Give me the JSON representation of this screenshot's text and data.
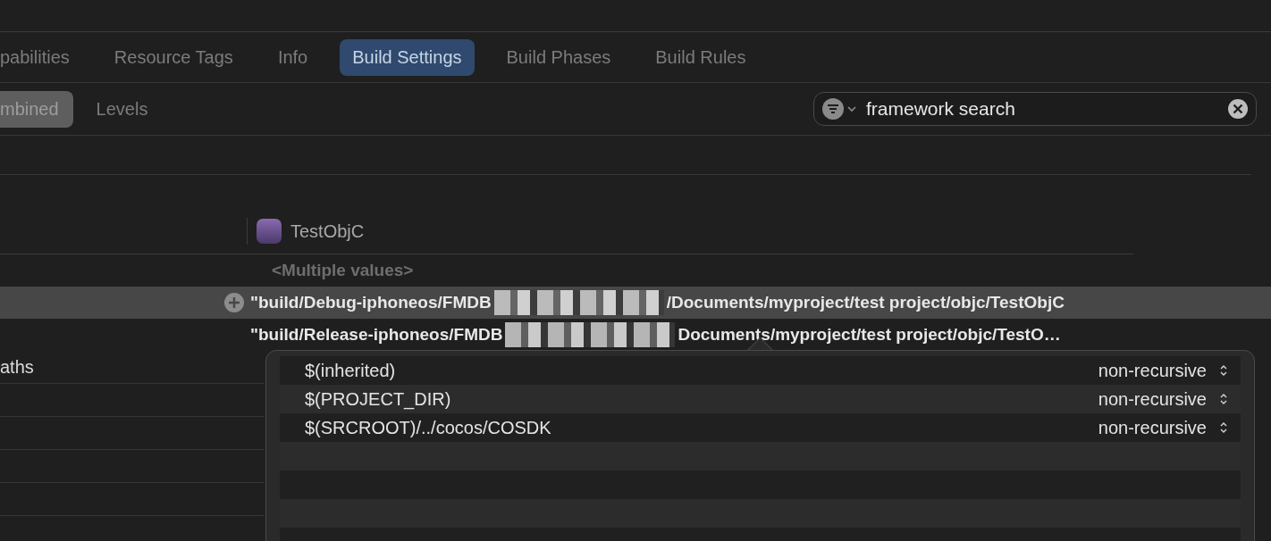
{
  "tabs": [
    {
      "label": "pabilities",
      "selected": false
    },
    {
      "label": "Resource Tags",
      "selected": false
    },
    {
      "label": "Info",
      "selected": false
    },
    {
      "label": "Build Settings",
      "selected": true
    },
    {
      "label": "Build Phases",
      "selected": false
    },
    {
      "label": "Build Rules",
      "selected": false
    }
  ],
  "view_modes": [
    {
      "label": "mbined",
      "selected": true
    },
    {
      "label": "Levels",
      "selected": false
    }
  ],
  "search": {
    "value": "framework search"
  },
  "table": {
    "target": "TestObjC",
    "rows": [
      {
        "kind": "placeholder",
        "text": "<Multiple values>",
        "selected": false
      },
      {
        "kind": "path",
        "text": "\"build/Debug-iphoneos/FMDB",
        "text_after": "/Documents/myproject/test project/objc/TestObjC",
        "selected": true
      },
      {
        "kind": "path",
        "text": "\"build/Release-iphoneos/FMDB",
        "text_after": "Documents/myproject/test project/objc/TestO…",
        "selected": false
      }
    ],
    "setting_names": [
      "aths"
    ]
  },
  "popover": {
    "entries": [
      {
        "path": "$(inherited)",
        "mode": "non-recursive"
      },
      {
        "path": "$(PROJECT_DIR)",
        "mode": "non-recursive"
      },
      {
        "path": "$(SRCROOT)/../cocos/COSDK",
        "mode": "non-recursive"
      }
    ]
  }
}
